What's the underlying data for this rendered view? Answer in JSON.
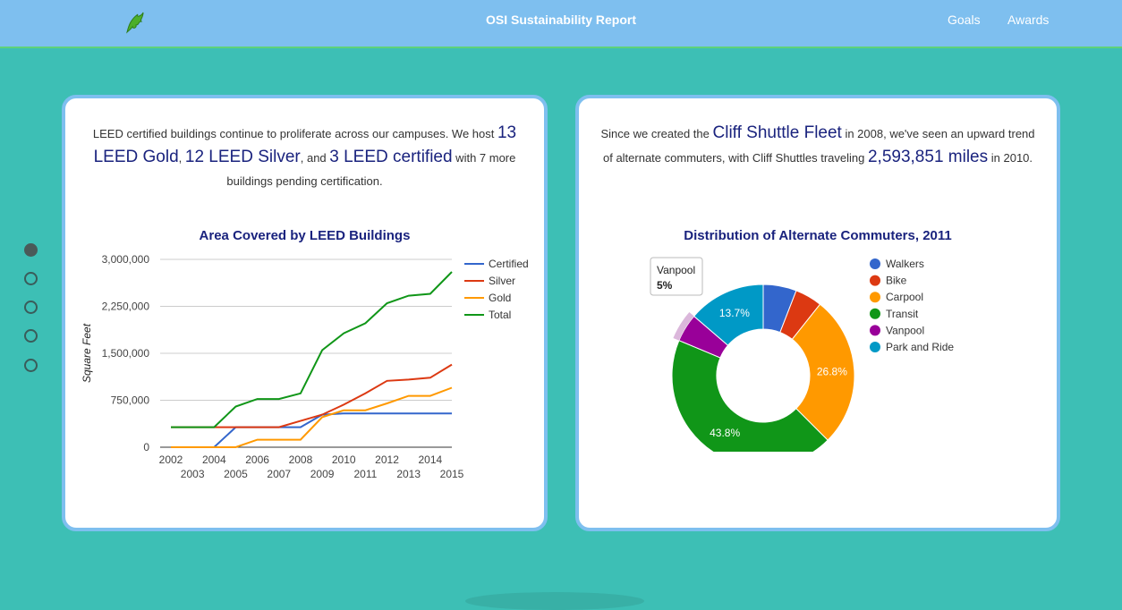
{
  "header": {
    "title": "OSI Sustainability Report",
    "nav": [
      "Goals",
      "Awards"
    ]
  },
  "slides": {
    "count": 5,
    "active": 0
  },
  "left_card": {
    "text_1": "LEED certified buildings continue to proliferate across our campuses. We host ",
    "num_gold": "13 LEED Gold",
    "text_2": ", ",
    "num_silver": "12 LEED Silver",
    "text_3": ", and ",
    "num_cert": "3 LEED certified",
    "text_4": " with 7 more buildings pending certification."
  },
  "right_card": {
    "text_1": "Since we created the ",
    "fleet": "Cliff Shuttle Fleet",
    "text_2": " in 2008, we've seen an upward trend of alternate commuters, with Cliff Shuttles traveling ",
    "miles": "2,593,851 miles",
    "text_3": " in 2010."
  },
  "tooltip": {
    "label": "Vanpool",
    "value": "5%"
  },
  "colors": {
    "background": "#3dbfb5",
    "header": "#7ebfef",
    "card_border": "#7ebfef",
    "title": "#1a237e"
  },
  "chart_data": [
    {
      "type": "line",
      "title": "Area Covered by LEED Buildings",
      "xlabel": "",
      "ylabel": "Square Feet",
      "x": [
        2002,
        2003,
        2004,
        2005,
        2006,
        2007,
        2008,
        2009,
        2010,
        2011,
        2012,
        2013,
        2014,
        2015
      ],
      "x_ticks_top": [
        "2002",
        "2004",
        "2006",
        "2008",
        "2010",
        "2012",
        "2014"
      ],
      "x_ticks_bottom": [
        "2003",
        "2005",
        "2007",
        "2009",
        "2011",
        "2013",
        "2015"
      ],
      "ylim": [
        0,
        3000000
      ],
      "y_ticks": [
        "0",
        "750,000",
        "1,500,000",
        "2,250,000",
        "3,000,000"
      ],
      "y_tick_values": [
        0,
        750000,
        1500000,
        2250000,
        3000000
      ],
      "grid": true,
      "legend_position": "right",
      "series": [
        {
          "name": "Certified",
          "color": "#3366cc",
          "values": [
            0,
            0,
            0,
            320000,
            320000,
            320000,
            320000,
            520000,
            540000,
            540000,
            540000,
            540000,
            540000,
            540000
          ]
        },
        {
          "name": "Silver",
          "color": "#dc3912",
          "values": [
            320000,
            320000,
            320000,
            320000,
            320000,
            320000,
            420000,
            520000,
            680000,
            860000,
            1060000,
            1080000,
            1110000,
            1320000
          ]
        },
        {
          "name": "Gold",
          "color": "#ff9900",
          "values": [
            0,
            0,
            0,
            0,
            120000,
            120000,
            120000,
            480000,
            590000,
            590000,
            700000,
            820000,
            820000,
            950000
          ]
        },
        {
          "name": "Total",
          "color": "#109618",
          "values": [
            320000,
            320000,
            320000,
            650000,
            770000,
            770000,
            860000,
            1550000,
            1820000,
            1980000,
            2300000,
            2420000,
            2450000,
            2800000
          ]
        }
      ]
    },
    {
      "type": "pie",
      "title": "Distribution of Alternate Commuters, 2011",
      "legend_position": "right",
      "labels": [
        "Walkers",
        "Bike",
        "Carpool",
        "Transit",
        "Vanpool",
        "Park and Ride"
      ],
      "values": [
        5.9,
        4.8,
        26.8,
        43.8,
        5.0,
        13.7
      ],
      "colors": [
        "#3366cc",
        "#dc3912",
        "#ff9900",
        "#109618",
        "#990099",
        "#0099c6"
      ],
      "shown_labels": [
        "",
        "",
        "26.8%",
        "43.8%",
        "",
        "13.7%"
      ]
    }
  ]
}
